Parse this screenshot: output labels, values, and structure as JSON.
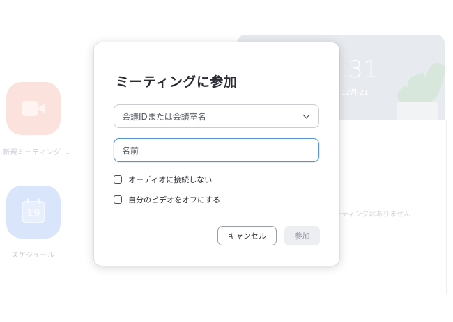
{
  "background": {
    "new_meeting_label": "新規ミーティング",
    "schedule_label": "スケジュール",
    "calendar_day": "19",
    "clock_time": ":31",
    "clock_date": "12月 21",
    "no_meetings": "ーティングはありません",
    "colors": {
      "new_tile": "#fbe2dd",
      "schedule_tile": "#d9e5fb"
    }
  },
  "dialog": {
    "title": "ミーティングに参加",
    "meeting_id": {
      "placeholder": "会議IDまたは会議室名",
      "value": ""
    },
    "name": {
      "placeholder": "名前",
      "value": ""
    },
    "options": [
      {
        "label": "オーディオに接続しない",
        "checked": false
      },
      {
        "label": "自分のビデオをオフにする",
        "checked": false
      }
    ],
    "cancel_label": "キャンセル",
    "join_label": "参加",
    "join_enabled": false,
    "colors": {
      "focus_border": "#5a92d8"
    }
  }
}
